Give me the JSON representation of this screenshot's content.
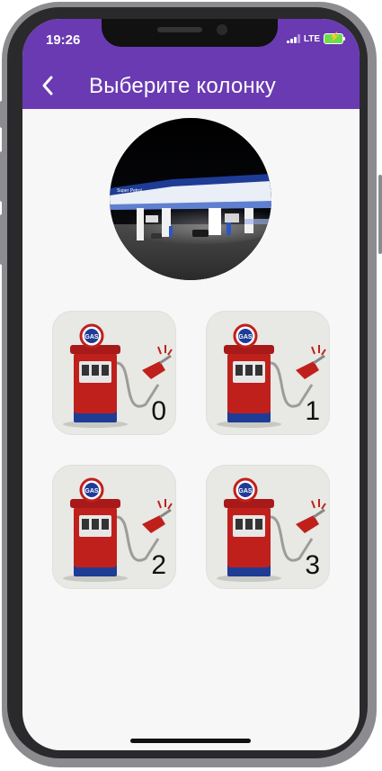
{
  "status_bar": {
    "time": "19:26",
    "network": "LTE"
  },
  "app_bar": {
    "back_icon": "chevron-left-icon",
    "title": "Выберите колонку"
  },
  "station_image": {
    "alt": "gas-station-night-photo"
  },
  "pumps": [
    {
      "number": "0",
      "icon": "gas-pump-icon",
      "sign": "GAS"
    },
    {
      "number": "1",
      "icon": "gas-pump-icon",
      "sign": "GAS"
    },
    {
      "number": "2",
      "icon": "gas-pump-icon",
      "sign": "GAS"
    },
    {
      "number": "3",
      "icon": "gas-pump-icon",
      "sign": "GAS"
    }
  ],
  "colors": {
    "primary": "#6a3ab2",
    "background": "#f7f7f7",
    "pump_red": "#c0201c",
    "pump_blue": "#1e3c96"
  }
}
